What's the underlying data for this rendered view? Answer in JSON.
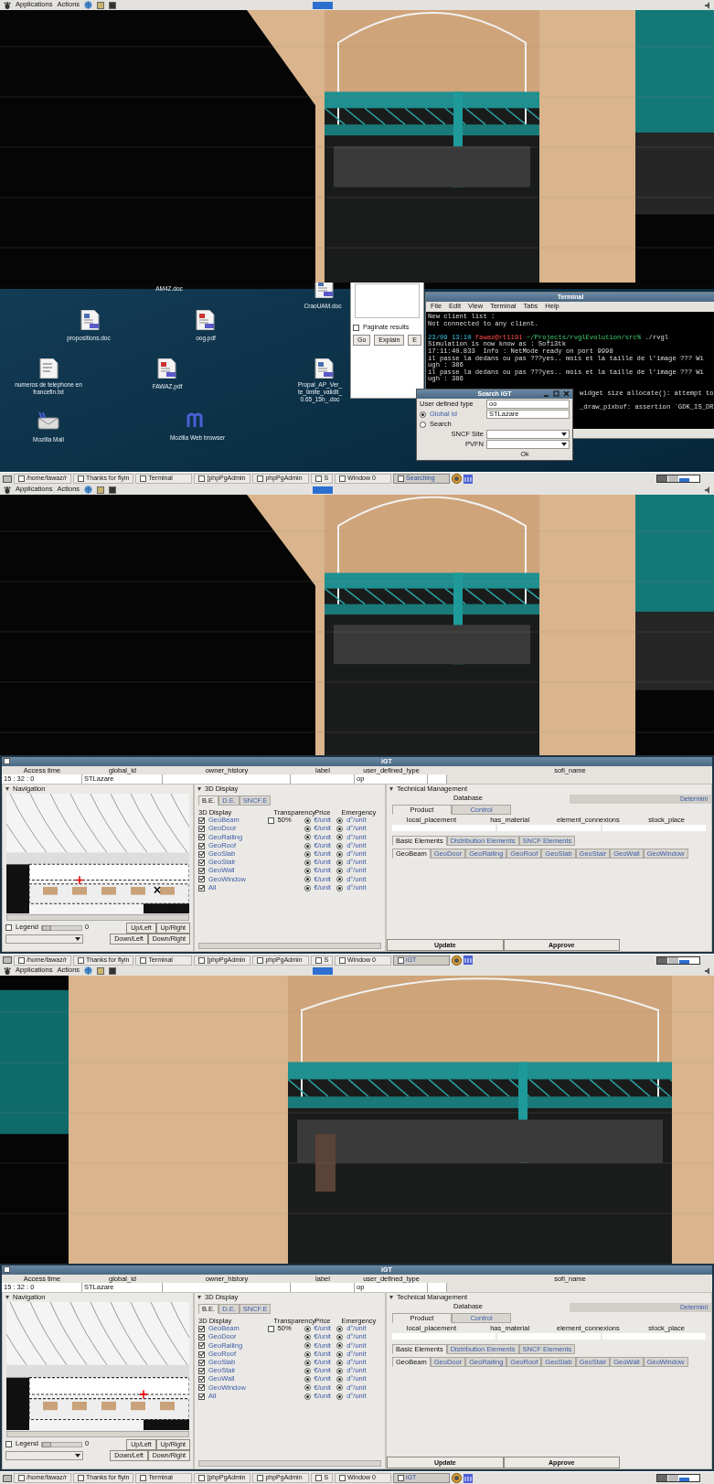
{
  "strips": [
    {
      "kind": "top_panel",
      "menus": [
        "Applications",
        "Actions"
      ]
    },
    {
      "kind": "scene"
    },
    {
      "kind": "desktop",
      "icons": [
        {
          "kind": "label_only",
          "label": "AM4Z.doc"
        },
        {
          "kind": "doc",
          "label": "propositions.doc"
        },
        {
          "kind": "pdf",
          "label": "oog.pdf"
        },
        {
          "kind": "doc",
          "label": "CraoUAM.doc"
        },
        {
          "kind": "text",
          "label": "numeros de telephone en francefin.txt"
        },
        {
          "kind": "pdf",
          "label": "FAWAZ.pdf"
        },
        {
          "kind": "doc",
          "label": "Propal_AP_Ver_ te_limite_validit_ 0.65_15h_.doc"
        },
        {
          "kind": "mail",
          "label": "Mozilla Mail"
        },
        {
          "kind": "browser",
          "label": "Mozilla Web browser"
        }
      ],
      "query_window": {
        "paginate": {
          "label": "Paginate results",
          "checked": false
        },
        "buttons": [
          "Go",
          "Explain",
          "E"
        ]
      },
      "terminal": {
        "title": "Terminal",
        "menus": [
          "File",
          "Edit",
          "View",
          "Terminal",
          "Tabs",
          "Help"
        ],
        "lines": [
          {
            "kind": "text",
            "text": "New client list :"
          },
          {
            "kind": "text",
            "text": "Not connected to any client."
          },
          {
            "kind": "blank"
          },
          {
            "kind": "prompt",
            "date": "23/09 13:10",
            "user": "fawaz@rt1191",
            "path": "~/Projects/rvglEvolution/src%",
            "command": "./rvgl"
          },
          {
            "kind": "text",
            "text": "Simulation is now know as : Sofi3tk"
          },
          {
            "kind": "text",
            "text": "17:11:40.833  Info : NetMode ready on port 9998"
          },
          {
            "kind": "text",
            "text": "il passe la dedans ou pas ???yes.. mois et la taille de l'image ??? Wi"
          },
          {
            "kind": "text",
            "text": "ugh : 386"
          },
          {
            "kind": "text",
            "text": "il passe la dedans ou pas ???yes.. mois et la taille de l'image ??? Wi"
          },
          {
            "kind": "text",
            "text": "ugh : 386"
          },
          {
            "kind": "blank"
          },
          {
            "kind": "tail",
            "text": "widget size allocate(): attempt to"
          },
          {
            "kind": "blank"
          },
          {
            "kind": "tail",
            "text": "_draw_pixbuf: assertion `GDK_IS_DR"
          }
        ]
      },
      "search_dialog": {
        "title": "Search iGT",
        "rows": [
          {
            "kind": "text",
            "label": "User defined type",
            "value": "oo"
          },
          {
            "kind": "radio",
            "label": "Global Id",
            "selected": true,
            "value": "STLazare"
          },
          {
            "kind": "radio",
            "label": "Search",
            "selected": false
          },
          {
            "kind": "select",
            "label": "SNCF Site"
          },
          {
            "kind": "select",
            "label": "PVFN"
          }
        ],
        "button": "Ok"
      }
    },
    {
      "kind": "taskbar",
      "buttons": [
        {
          "label": "/home/fawaz/r",
          "selected": false
        },
        {
          "label": "Thanks for flyin",
          "selected": false
        },
        {
          "label": "Terminal",
          "selected": false
        },
        {
          "label": "[phpPgAdmin",
          "selected": false
        },
        {
          "label": "phpPgAdmin",
          "selected": false
        },
        {
          "label": "S",
          "selected": false
        },
        {
          "label": "Window 0",
          "selected": false
        },
        {
          "label": "Searching",
          "selected": true
        }
      ]
    },
    {
      "kind": "top_panel",
      "menus": [
        "Applications",
        "Actions"
      ]
    },
    {
      "kind": "scene"
    },
    {
      "kind": "igt",
      "title": "iGT",
      "header": {
        "columns": [
          {
            "name": "Access time",
            "value": "15 : 32 : 0"
          },
          {
            "name": "global_id",
            "value": "STLazare"
          },
          {
            "name": "owner_history"
          },
          {
            "name": "label"
          },
          {
            "name": "user_defined_type",
            "value": "op"
          },
          {
            "name": "sofi_name"
          }
        ]
      },
      "navigation": {
        "title": "Navigation",
        "legend": {
          "label": "Legend",
          "checked": false
        },
        "zoom": {
          "level": 0,
          "reading": "0"
        },
        "buttons": [
          "Up/Left",
          "Up/Right",
          "Down/Left",
          "Down/Right"
        ]
      },
      "display": {
        "title": "3D Display",
        "tabs": [
          {
            "label": "B.E.",
            "selected": true
          },
          {
            "label": "D.E.",
            "selected": false
          },
          {
            "label": "SNCF.E",
            "selected": false
          }
        ],
        "headings": [
          "3D Display",
          "Transparency",
          "Price",
          "Emergency"
        ],
        "rows": [
          {
            "label": "GeoBeam",
            "checked": true,
            "transparency": {
              "label": "50%",
              "checked": false
            },
            "price": {
              "label": "€/unit",
              "selected": true
            },
            "emergency": {
              "label": "d°/unit",
              "selected": true
            }
          },
          {
            "label": "GeoDoor",
            "checked": true,
            "price": {
              "label": "€/unit",
              "selected": true
            },
            "emergency": {
              "label": "d°/unit",
              "selected": true
            }
          },
          {
            "label": "GeoRailing",
            "checked": true,
            "price": {
              "label": "€/unit",
              "selected": true
            },
            "emergency": {
              "label": "d°/unit",
              "selected": true
            }
          },
          {
            "label": "GeoRoof",
            "checked": true,
            "price": {
              "label": "€/unit",
              "selected": true
            },
            "emergency": {
              "label": "d°/unit",
              "selected": true
            }
          },
          {
            "label": "GeoSlab",
            "checked": true,
            "price": {
              "label": "€/unit",
              "selected": true
            },
            "emergency": {
              "label": "d°/unit",
              "selected": true
            }
          },
          {
            "label": "GeoStair",
            "checked": true,
            "price": {
              "label": "€/unit",
              "selected": true
            },
            "emergency": {
              "label": "d°/unit",
              "selected": true
            }
          },
          {
            "label": "GeoWall",
            "checked": true,
            "price": {
              "label": "€/unit",
              "selected": true
            },
            "emergency": {
              "label": "d°/unit",
              "selected": true
            }
          },
          {
            "label": "GeoWindow",
            "checked": true,
            "price": {
              "label": "€/unit",
              "selected": true
            },
            "emergency": {
              "label": "d°/unit",
              "selected": true
            }
          },
          {
            "label": "All",
            "checked": true,
            "price": {
              "label": "€/unit",
              "selected": true
            },
            "emergency": {
              "label": "d°/unit",
              "selected": true
            }
          }
        ]
      },
      "technical": {
        "title": "Technical Management",
        "database": "Database",
        "determine": "Determini",
        "tabs": [
          {
            "label": "Product",
            "selected": true
          },
          {
            "label": "Control",
            "selected": false
          }
        ],
        "columns": [
          "local_placement",
          "has_material",
          "element_connexions",
          "stock_place"
        ],
        "element_tabs": [
          {
            "label": "Basic Elements",
            "selected": true
          },
          {
            "label": "Distribution Elements",
            "selected": false
          },
          {
            "label": "SNCF Elements",
            "selected": false
          }
        ],
        "geo_tabs": [
          {
            "label": "GeoBeam",
            "selected": true
          },
          {
            "label": "GeoDoor",
            "selected": false
          },
          {
            "label": "GeoRailing",
            "selected": false
          },
          {
            "label": "GeoRoof",
            "selected": false
          },
          {
            "label": "GeoSlab",
            "selected": false
          },
          {
            "label": "GeoStair",
            "selected": false
          },
          {
            "label": "GeoWall",
            "selected": false
          },
          {
            "label": "GeoWindow",
            "selected": false
          }
        ],
        "buttons": [
          "Update",
          "Approve"
        ]
      }
    },
    {
      "kind": "taskbar",
      "buttons": [
        {
          "label": "/home/fawaz/r",
          "selected": false
        },
        {
          "label": "Thanks for flyin",
          "selected": false
        },
        {
          "label": "Terminal",
          "selected": false
        },
        {
          "label": "[phpPgAdmin",
          "selected": false
        },
        {
          "label": "phpPgAdmin",
          "selected": false
        },
        {
          "label": "S",
          "selected": false
        },
        {
          "label": "Window 0",
          "selected": false
        },
        {
          "label": "iGT",
          "selected": true
        }
      ]
    },
    {
      "kind": "top_panel",
      "menus": [
        "Applications",
        "Actions"
      ]
    },
    {
      "kind": "scene"
    },
    {
      "kind": "igt",
      "title": "iGT",
      "header": {
        "columns": [
          {
            "name": "Access time",
            "value": "15 : 32 : 0"
          },
          {
            "name": "global_id",
            "value": "STLazare"
          },
          {
            "name": "owner_history"
          },
          {
            "name": "label"
          },
          {
            "name": "user_defined_type",
            "value": "op"
          },
          {
            "name": "sofi_name"
          }
        ]
      },
      "navigation": {
        "title": "Navigation",
        "legend": {
          "label": "Legend",
          "checked": false
        },
        "zoom": {
          "level": 0,
          "reading": "0"
        },
        "buttons": [
          "Up/Left",
          "Up/Right",
          "Down/Left",
          "Down/Right"
        ]
      },
      "display": {
        "title": "3D Display",
        "tabs": [
          {
            "label": "B.E.",
            "selected": true
          },
          {
            "label": "D.E.",
            "selected": false
          },
          {
            "label": "SNCF.E",
            "selected": false
          }
        ],
        "headings": [
          "3D Display",
          "Transparency",
          "Price",
          "Emergency"
        ],
        "rows": [
          {
            "label": "GeoBeam",
            "checked": true,
            "transparency": {
              "label": "50%",
              "checked": false
            },
            "price": {
              "label": "€/unit",
              "selected": true
            },
            "emergency": {
              "label": "d°/unit",
              "selected": true
            }
          },
          {
            "label": "GeoDoor",
            "checked": true,
            "price": {
              "label": "€/unit",
              "selected": true
            },
            "emergency": {
              "label": "d°/unit",
              "selected": true
            }
          },
          {
            "label": "GeoRailing",
            "checked": true,
            "price": {
              "label": "€/unit",
              "selected": true
            },
            "emergency": {
              "label": "d°/unit",
              "selected": true
            }
          },
          {
            "label": "GeoRoof",
            "checked": true,
            "price": {
              "label": "€/unit",
              "selected": true
            },
            "emergency": {
              "label": "d°/unit",
              "selected": true
            }
          },
          {
            "label": "GeoSlab",
            "checked": true,
            "price": {
              "label": "€/unit",
              "selected": true
            },
            "emergency": {
              "label": "d°/unit",
              "selected": true
            }
          },
          {
            "label": "GeoStair",
            "checked": true,
            "price": {
              "label": "€/unit",
              "selected": true
            },
            "emergency": {
              "label": "d°/unit",
              "selected": true
            }
          },
          {
            "label": "GeoWall",
            "checked": true,
            "price": {
              "label": "€/unit",
              "selected": true
            },
            "emergency": {
              "label": "d°/unit",
              "selected": true
            }
          },
          {
            "label": "GeoWindow",
            "checked": true,
            "price": {
              "label": "€/unit",
              "selected": true
            },
            "emergency": {
              "label": "d°/unit",
              "selected": true
            }
          },
          {
            "label": "All",
            "checked": true,
            "price": {
              "label": "€/unit",
              "selected": true
            },
            "emergency": {
              "label": "d°/unit",
              "selected": true
            }
          }
        ]
      },
      "technical": {
        "title": "Technical Management",
        "database": "Database",
        "determine": "Determini",
        "tabs": [
          {
            "label": "Product",
            "selected": true
          },
          {
            "label": "Control",
            "selected": false
          }
        ],
        "columns": [
          "local_placement",
          "has_material",
          "element_connexions",
          "stock_place"
        ],
        "element_tabs": [
          {
            "label": "Basic Elements",
            "selected": true
          },
          {
            "label": "Distribution Elements",
            "selected": false
          },
          {
            "label": "SNCF Elements",
            "selected": false
          }
        ],
        "geo_tabs": [
          {
            "label": "GeoBeam",
            "selected": true
          },
          {
            "label": "GeoDoor",
            "selected": false
          },
          {
            "label": "GeoRailing",
            "selected": false
          },
          {
            "label": "GeoRoof",
            "selected": false
          },
          {
            "label": "GeoSlab",
            "selected": false
          },
          {
            "label": "GeoStair",
            "selected": false
          },
          {
            "label": "GeoWall",
            "selected": false
          },
          {
            "label": "GeoWindow",
            "selected": false
          }
        ],
        "buttons": [
          "Update",
          "Approve"
        ]
      }
    },
    {
      "kind": "taskbar",
      "buttons": [
        {
          "label": "/home/fawaz/r",
          "selected": false
        },
        {
          "label": "Thanks for flyin",
          "selected": false
        },
        {
          "label": "Terminal",
          "selected": false
        },
        {
          "label": "[phpPgAdmin",
          "selected": false
        },
        {
          "label": "phpPgAdmin",
          "selected": false
        },
        {
          "label": "S",
          "selected": false
        },
        {
          "label": "Window 0",
          "selected": false
        },
        {
          "label": "iGT",
          "selected": true
        }
      ]
    }
  ]
}
